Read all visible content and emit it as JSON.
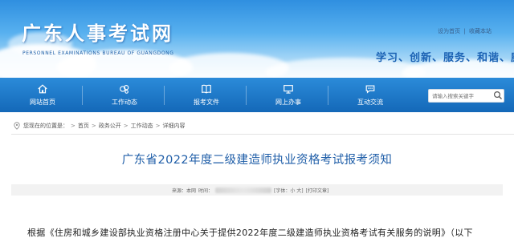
{
  "header": {
    "logo_text": "广东人事考试网",
    "logo_sub": "PERSONNEL EXAMINATIONS BUREAU OF GUANGDONG",
    "links": [
      "设为首页",
      "|",
      "收藏本站"
    ],
    "slogan": "学习、创新、服务、和谐、廉洁"
  },
  "nav": {
    "items": [
      {
        "label": "网站首页",
        "icon": "home-icon"
      },
      {
        "label": "工作动态",
        "icon": "bubbles-icon"
      },
      {
        "label": "报考文件",
        "icon": "book-icon"
      },
      {
        "label": "网上办事",
        "icon": "monitor-icon"
      },
      {
        "label": "互动交流",
        "icon": "chat-icon"
      }
    ],
    "search_placeholder": "请输入搜索关键字"
  },
  "breadcrumb": {
    "prefix": "您现在的位置是：",
    "items": [
      "首页",
      "政务公开",
      "工作动态",
      "详细内容"
    ]
  },
  "article": {
    "title": "广东省2022年度二级建造师执业资格考试报考须知",
    "meta_source": "来源：本网",
    "meta_date_label": "时间：",
    "meta_font": "[字体：小 大]",
    "meta_print": "[打印文章]",
    "body_start": "根据《住房和城乡建设部执业资格注册中心关于提供2022年度二级建造师执业资格考试有关服务的说明》（以下"
  }
}
